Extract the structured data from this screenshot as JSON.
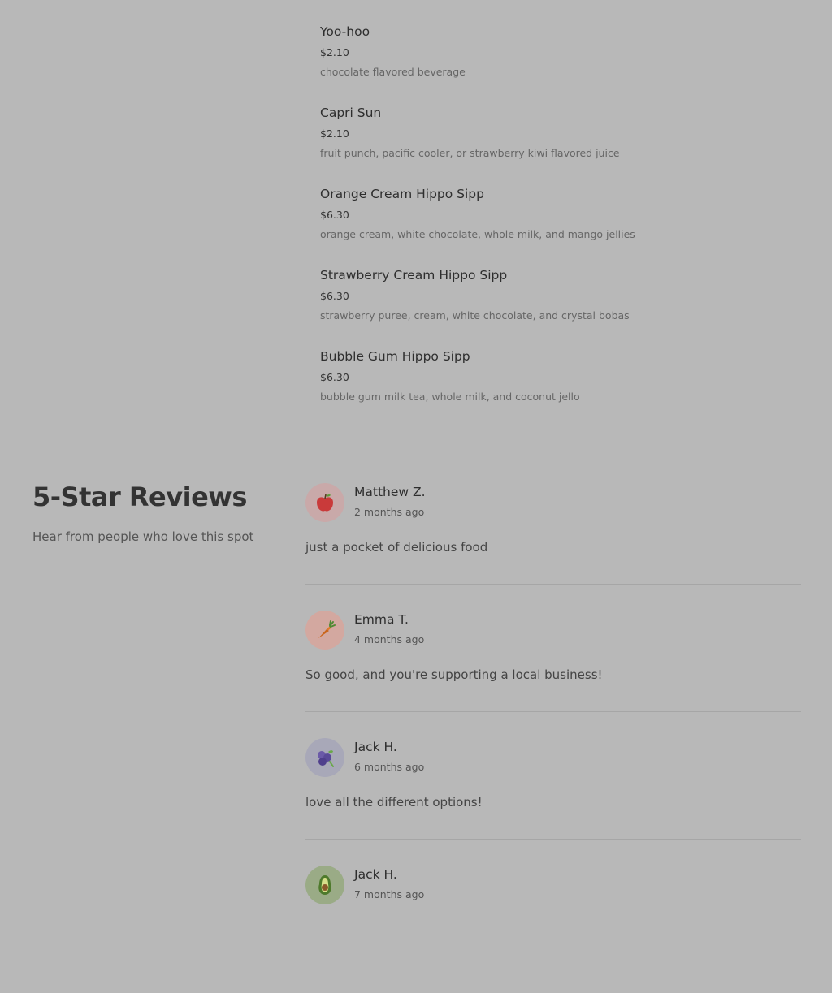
{
  "menu": {
    "items": [
      {
        "name": "Yoo-hoo",
        "price": "$2.10",
        "description": "chocolate flavored beverage"
      },
      {
        "name": "Capri Sun",
        "price": "$2.10",
        "description": "fruit punch, pacific cooler, or strawberry kiwi flavored juice"
      },
      {
        "name": "Orange Cream Hippo Sipp",
        "price": "$6.30",
        "description": "orange cream, white chocolate, whole milk, and mango jellies"
      },
      {
        "name": "Strawberry Cream Hippo Sipp",
        "price": "$6.30",
        "description": "strawberry puree, cream, white chocolate, and crystal bobas"
      },
      {
        "name": "Bubble Gum Hippo Sipp",
        "price": "$6.30",
        "description": "bubble gum milk tea, whole milk, and coconut jello"
      }
    ]
  },
  "reviews": {
    "title": "5-Star Reviews",
    "subtitle": "Hear from people who love this spot",
    "items": [
      {
        "author": "Matthew Z.",
        "date": "2 months ago",
        "text": "just a pocket of delicious food",
        "avatar_icon": "apple-icon",
        "avatar_bg": "#c9a9a9"
      },
      {
        "author": "Emma T.",
        "date": "4 months ago",
        "text": "So good, and you're supporting a local business!",
        "avatar_icon": "carrot-icon",
        "avatar_bg": "#d3a8a0"
      },
      {
        "author": "Jack H.",
        "date": "6 months ago",
        "text": "love all the different options!",
        "avatar_icon": "blueberry-icon",
        "avatar_bg": "#a8a8b8"
      },
      {
        "author": "Jack H.",
        "date": "7 months ago",
        "text": "",
        "avatar_icon": "avocado-icon",
        "avatar_bg": "#9aab86"
      }
    ]
  }
}
